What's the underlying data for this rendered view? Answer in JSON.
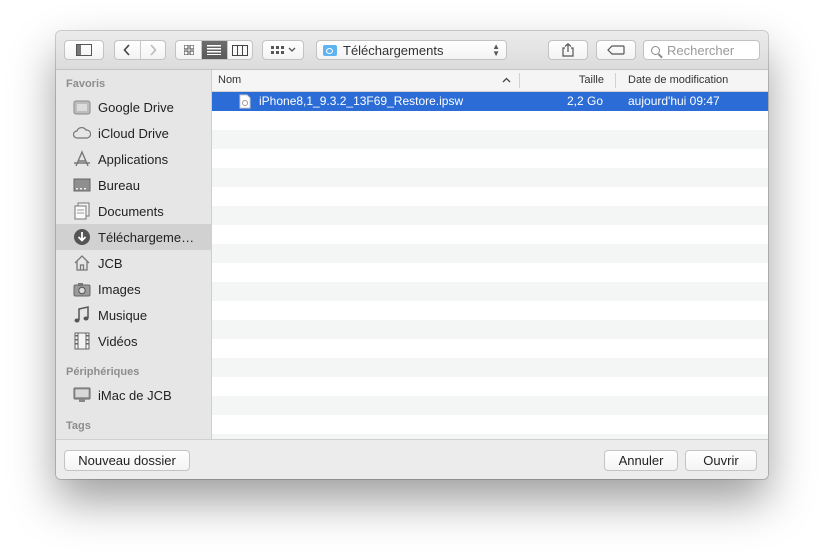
{
  "toolbar": {
    "location": "Téléchargements",
    "search_placeholder": "Rechercher"
  },
  "sidebar": {
    "sections": {
      "favorites": "Favoris",
      "devices": "Périphériques",
      "tags": "Tags"
    },
    "favorites": [
      {
        "label": "Google Drive",
        "icon": "google-drive-icon"
      },
      {
        "label": "iCloud Drive",
        "icon": "icloud-icon"
      },
      {
        "label": "Applications",
        "icon": "applications-icon"
      },
      {
        "label": "Bureau",
        "icon": "desktop-icon"
      },
      {
        "label": "Documents",
        "icon": "documents-icon"
      },
      {
        "label": "Téléchargeme…",
        "icon": "downloads-icon",
        "selected": true
      },
      {
        "label": "JCB",
        "icon": "home-icon"
      },
      {
        "label": "Images",
        "icon": "camera-icon"
      },
      {
        "label": "Musique",
        "icon": "music-icon"
      },
      {
        "label": "Vidéos",
        "icon": "film-icon"
      }
    ],
    "devices": [
      {
        "label": "iMac de JCB",
        "icon": "imac-icon"
      }
    ]
  },
  "list": {
    "columns": {
      "name": "Nom",
      "size": "Taille",
      "modified": "Date de modification"
    },
    "files": [
      {
        "name": "iPhone8,1_9.3.2_13F69_Restore.ipsw",
        "size": "2,2 Go",
        "modified": "aujourd'hui 09:47",
        "selected": true
      }
    ]
  },
  "buttons": {
    "new_folder": "Nouveau dossier",
    "cancel": "Annuler",
    "open": "Ouvrir"
  },
  "colors": {
    "selection": "#2c6cd6",
    "sidebar_selection": "#d1d1d1",
    "downloads_folder": "#5fb3f0"
  }
}
